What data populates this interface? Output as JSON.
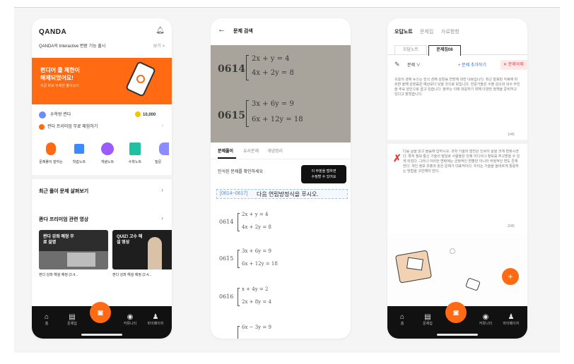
{
  "phone1": {
    "brand": "QANDA",
    "notice": "QANDA의 Interactive 변환 기능 출시",
    "notice_more": "보기 >",
    "banner_line1": "펀디어 콜 제한이",
    "banner_line2": "해제되었어요!",
    "banner_sub": "지금 바로 무제한 풀이보기",
    "profile_name": "수학왕 콴다",
    "coins": "10,000",
    "mission": "콴다 프리미엄 무료 체험하기",
    "categories": [
      "문제풀이 잘하는",
      "학습노트",
      "개념노트",
      "수학노트",
      "질문"
    ],
    "section1": "최근 풀이 문제 살펴보기",
    "section2": "콴다 프리미엄 관련 영상",
    "video1_title": "콴다 강좌 예정 무료 설명",
    "video1_caption": "콴다 강좌 해설 예정 (2.4...",
    "video2_title": "QUIZ! 고수 해설 영상",
    "video2_caption": "콴다 강좌 해설 예정 (2.4...",
    "tabs": [
      "홈",
      "문제집",
      "",
      "커뮤니티",
      "마이페이지"
    ]
  },
  "phone2": {
    "header_title": "문제 검색",
    "photo_row1_num": "0614",
    "photo_row1_eq1": "2x + y = 4",
    "photo_row1_eq2": "4x + 2y = 8",
    "photo_row2_num": "0615",
    "photo_row2_eq1": "3x + 6y = 9",
    "photo_row2_eq2": "6x + 12y = 18",
    "tabs": [
      "문제풀이",
      "유사문제",
      "개념정리"
    ],
    "result_label": "인식된 문제를 확인하세요",
    "tooltip_line1": "이 부분을 탭하면",
    "tooltip_line2": "수정할 수 있어요",
    "question_prefix": "[0614~0617]",
    "question_text": "다음 연립방정식을 푸시오.",
    "problems": [
      {
        "num": "0614",
        "eq1": "2x + y = 4",
        "eq2": "4x + 2y = 8"
      },
      {
        "num": "0615",
        "eq1": "3x + 6y = 9",
        "eq2": "6x + 12y = 18"
      },
      {
        "num": "0616",
        "eq1": "x + 4y = 2",
        "eq2": "2x + 8y = 4"
      },
      {
        "num": "",
        "eq1": "6x − 3y = 9",
        "eq2": ""
      }
    ]
  },
  "phone3": {
    "top_tabs": [
      "오답노트",
      "문제집",
      "자료함함"
    ],
    "sub_tabs": [
      "오답노트",
      "문제집08"
    ],
    "toolbar_select": "문제 ∨",
    "toolbar_add": "+ 문제 추가하기",
    "toolbar_delete": "✕ 문제삭제",
    "paragraph1": "오늘의 경제 뉴스는 한국 경제 성장률 전망에 대한 내용입니다. 최근 발표된 자료에 따르면 올해 성장률은 예상보다 낮을 것으로 보입니다. 전문가들은 수출 감소와 내수 부진을 주요 원인으로 꼽고 있습니다. 정부는 이에 대응하기 위해 다양한 정책을 준비하고 있다고 밝혔습니다.",
    "page1": "1/45",
    "paragraph2": "다음 글을 읽고 물음에 답하시오. 과학 기술의 발전은 인류의 삶을 크게 변화시켰다. 특히 정보 통신 기술의 발달로 사람들은 언제 어디서나 정보를 주고받을 수 있게 되었다. 그러나 이러한 변화에는 긍정적인 면뿐만 아니라 부정적인 면도 존재한다. 개인 정보 유출과 같은 문제가 대표적이다. 우리는 기술을 올바르게 활용하는 방법을 고민해야 한다.",
    "page2": "2/45",
    "tabs": [
      "홈",
      "문제집",
      "",
      "커뮤니티",
      "마이페이지"
    ]
  },
  "colors": {
    "accent": "#ff6a13",
    "tabbar": "#111111",
    "stage": "#f5f5f6"
  }
}
